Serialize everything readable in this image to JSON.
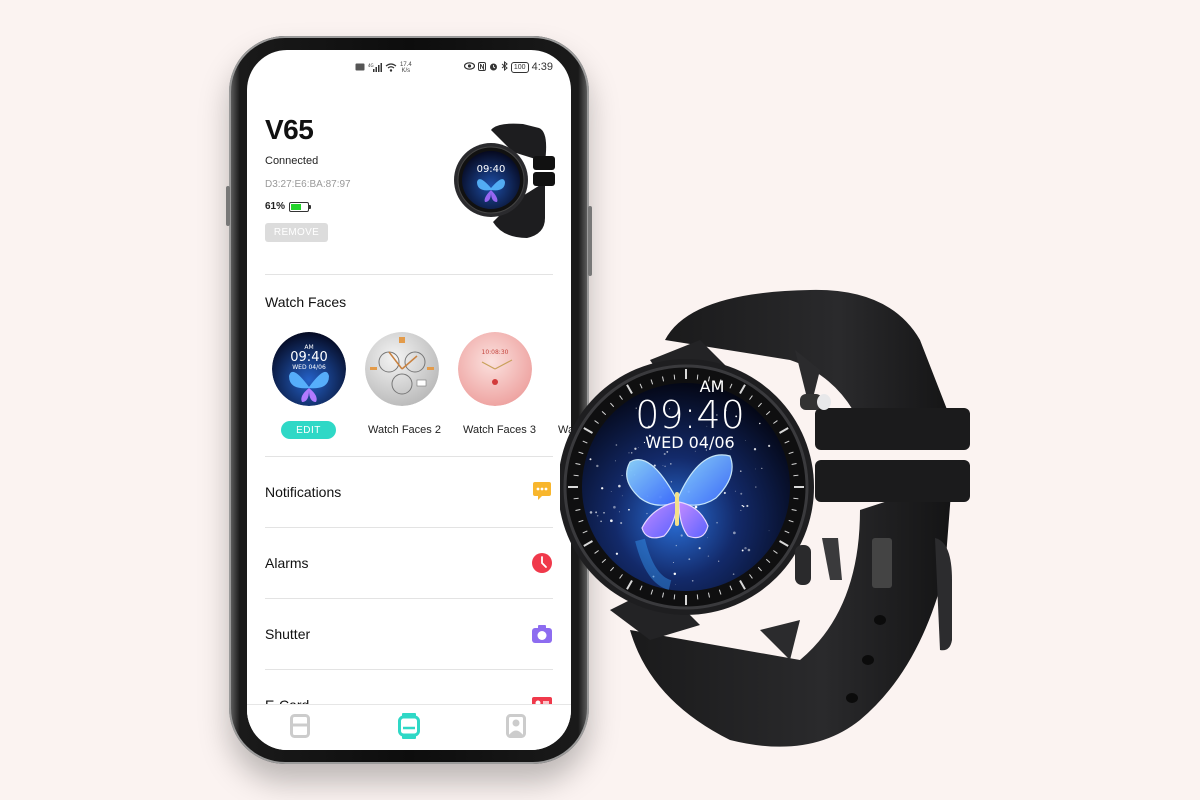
{
  "status_bar": {
    "left_icons": [
      "hd-icon",
      "4g-signal-icon",
      "wifi-icon"
    ],
    "network_speed_value": "17.4",
    "network_speed_unit": "K/s",
    "right_icons": [
      "eye-icon",
      "nfc-icon",
      "alarm-icon",
      "bluetooth-icon"
    ],
    "battery_level": "100",
    "time": "4:39"
  },
  "device": {
    "name": "V65",
    "status": "Connected",
    "mac_address": "D3:27:E6:BA:87:97",
    "battery_percent_label": "61%",
    "battery_fraction": 0.61,
    "remove_label": "REMOVE"
  },
  "watch_faces": {
    "title": "Watch Faces",
    "edit_label": "EDIT",
    "items": [
      {
        "label": "",
        "time": "09:40",
        "ampm": "AM",
        "date": "WED 04/06",
        "style": "butterfly"
      },
      {
        "label": "Watch Faces 2",
        "style": "silver-chronograph"
      },
      {
        "label": "Watch Faces 3",
        "style": "pink-marble"
      },
      {
        "label": "Wa",
        "style": "partial"
      }
    ]
  },
  "menu": [
    {
      "label": "Notifications",
      "icon": "chat-bubble-icon",
      "color": "#f8b62d"
    },
    {
      "label": "Alarms",
      "icon": "alarm-clock-icon",
      "color": "#f0394b"
    },
    {
      "label": "Shutter",
      "icon": "camera-icon",
      "color": "#8d6cf0"
    },
    {
      "label": "E-Card",
      "icon": "id-card-icon",
      "color": "#f0394b"
    }
  ],
  "tabbar": {
    "tabs": [
      {
        "name": "dashboard",
        "icon": "dashboard-icon",
        "active": false
      },
      {
        "name": "device",
        "icon": "watch-icon",
        "active": true
      },
      {
        "name": "profile",
        "icon": "profile-icon",
        "active": false
      }
    ],
    "accent_color": "#2fd8c6",
    "inactive_color": "#cccccc"
  },
  "product_watch": {
    "ampm": "AM",
    "time": "09:40",
    "date": "WED 04/06"
  }
}
